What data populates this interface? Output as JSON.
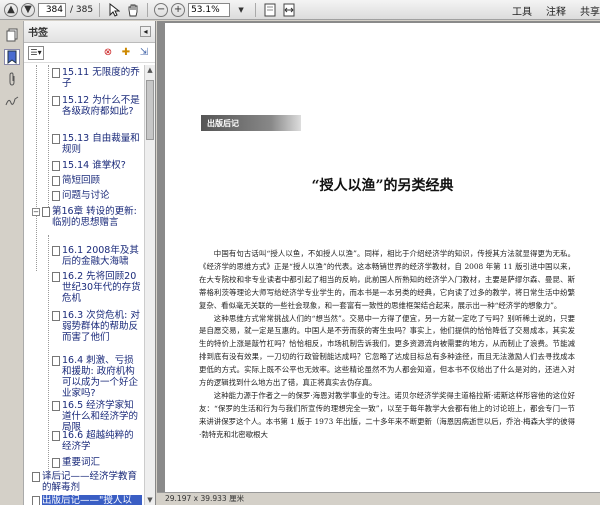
{
  "toolbar": {
    "page_current": "384",
    "page_total": "/ 385",
    "zoom": "53.1%",
    "right_items": [
      "工具",
      "注释",
      "共享"
    ]
  },
  "panel": {
    "title": "书签"
  },
  "bookmarks": [
    {
      "label": "15.11 无限度的乔子"
    },
    {
      "label": "15.12 为什么不是各级政府都如此?"
    },
    {
      "label": "15.13 自由裁量和规则"
    },
    {
      "label": "15.14 谁掌权?"
    },
    {
      "label": "简短回顾"
    },
    {
      "label": "问题与讨论"
    },
    {
      "label": "第16章 转设的更新: 临别的思想赠言"
    },
    {
      "label": "16.1 2008年及其后的金融大海啸"
    },
    {
      "label": "16.2 先将回顾20世纪30年代的存货危机"
    },
    {
      "label": "16.3 次贷危机: 对弱势群体的帮助反而害了他们"
    },
    {
      "label": "16.4 刺激、亏损和援助: 政府机构可以成为一个好企业家吗?"
    },
    {
      "label": "16.5 经济学家知道什么和经济学的局限"
    },
    {
      "label": "16.6 超越纯粹的经济学"
    },
    {
      "label": "重要词汇"
    },
    {
      "label": "译后记——经济学教育的解毒剂"
    },
    {
      "label": "出版后记——\"授人以渔\"的另类经典"
    }
  ],
  "document": {
    "section_label": "出版后记",
    "title": "“授人以渔”的另类经典",
    "paragraphs": [
      "中国有句古话叫“授人以鱼，不如授人以渔”。同样，相比于介绍经济学的知识，传授其方法就显得更为无私。《经济学的思维方式》正是“授人以渔”的代表。这本畅销世界的经济学教材，自 2008 年第 11 版引进中国以来，在大专院校和非专业读者中都引起了相当的反响，此前国人所熟知的经济学入门教材，主要是萨缪尔森、曼昆、斯蒂格利茨等理论大师写给经济学专业学生的，而本书是一本另类的经典，它向读了过多的教学，将日常生活中纷繁复杂、看似毫无关联的一些社会现象，和一套富有一致性的思维框架结合起来，展示出一种“经济学的想象力”。",
      "这种思维方式常常挑战人们的“想当然”。交易中一方得了便宜，另一方就一定吃了亏吗？别听稀土说的，只要是自愿交易，就一定是互惠的。中国人是不劳而获的寄生虫吗？事实上，他们提供的恰恰降低了交易成本，其实发生的特价上涨是敲竹杠吗？恰恰相反，市场机制告诉我们，更多资源流向被需要的地方，从而制止了浪费。节能减排到底有没有效果，一刀切的行政管制能达成吗？它忽略了达成目标总有多种途径，而且无法激励人们去寻找成本更低的方式。实际上既不公平也无效率。这些精论虽然不为人都会知道，但本书不仅给出了什么是对的，还进入对方的逻辑找到什么地方出了错，真正将真实去伪存真。",
      "这种能力源于作者之一的保罗·海恩对教学事业的专注。诺贝尔经济学奖得主道格拉斯·诺斯这样形容他的这位好友：“保罗的生活和行为与我们所宣传的理想完全一致”，以至于每年教学大会都有他上的讨论班上，都会专门一节来讲讲保罗这个人。本书第 1 版于 1973 年出版，二十多年来不断更新（海恩因病逝世以后，乔治·梅森大学的彼得·勃特克和北密歇根大"
    ]
  },
  "status": {
    "page_size": "29.197 x 39.933 厘米"
  }
}
